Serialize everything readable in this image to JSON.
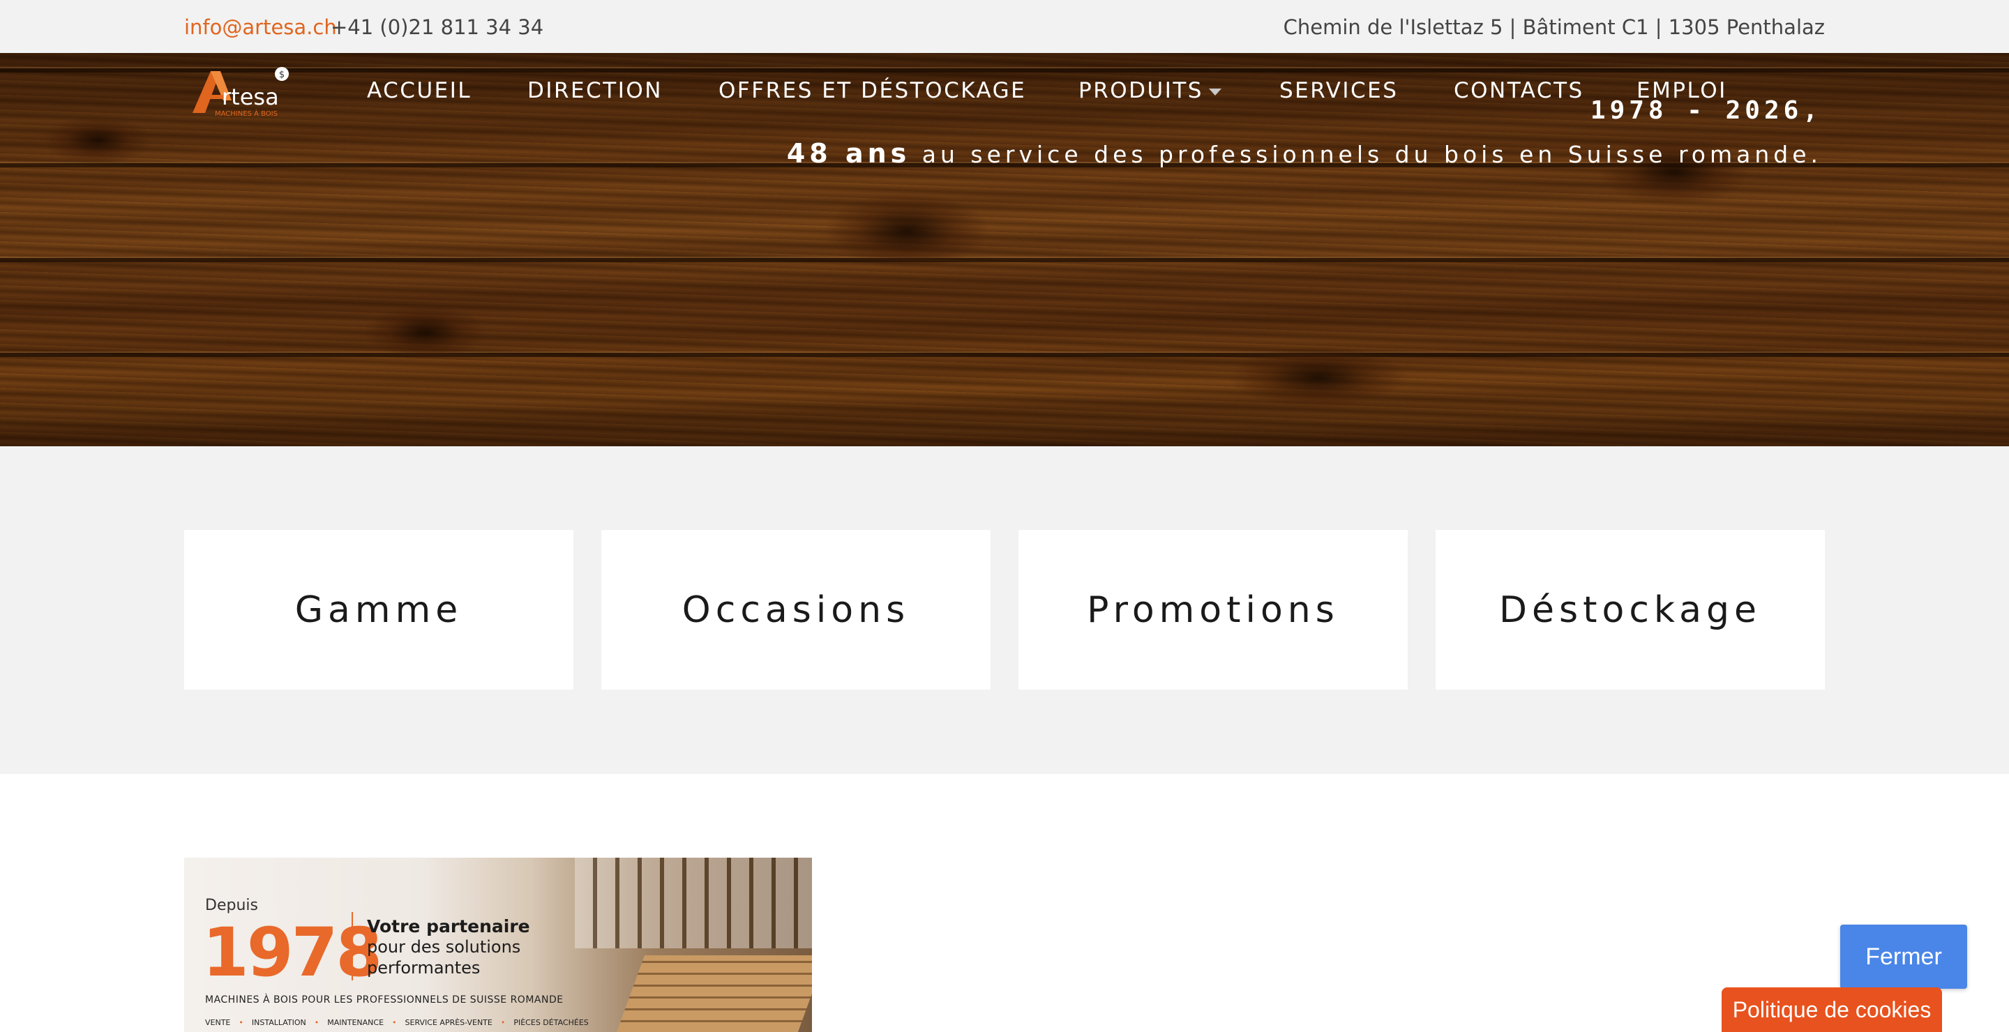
{
  "topbar": {
    "email": "info@artesa.ch",
    "phone": "+41 (0)21 811 34 34",
    "address": "Chemin de l'Islettaz 5 | Bâtiment C1 | 1305 Penthalaz"
  },
  "logo": {
    "name": "Artesa",
    "subtitle": "MACHINES À BOIS"
  },
  "nav": {
    "items": [
      {
        "label": "ACCUEIL"
      },
      {
        "label": "DIRECTION"
      },
      {
        "label": "OFFRES ET DÉSTOCKAGE"
      },
      {
        "label": "PRODUITS"
      },
      {
        "label": "SERVICES"
      },
      {
        "label": "CONTACTS"
      },
      {
        "label": "EMPLOI"
      }
    ]
  },
  "hero": {
    "years": "1978 - 2026,",
    "highlight": "48 ans",
    "tagline": "au service des professionnels du bois en Suisse romande."
  },
  "categories": [
    {
      "label": "Gamme"
    },
    {
      "label": "Occasions"
    },
    {
      "label": "Promotions"
    },
    {
      "label": "Déstockage"
    }
  ],
  "banner": {
    "depuis": "Depuis",
    "year": "1978",
    "line1": "Votre partenaire",
    "line2": "pour des solutions",
    "line3": "performantes",
    "subtitle": "MACHINES À BOIS POUR LES PROFESSIONNELS DE SUISSE ROMANDE",
    "services": [
      "VENTE",
      "INSTALLATION",
      "MAINTENANCE",
      "SERVICE APRÈS-VENTE",
      "PIÈCES DÉTACHÉES"
    ]
  },
  "cookies": {
    "close_label": "Fermer",
    "policy_label": "Politique de cookies"
  },
  "colors": {
    "accent": "#e0651f",
    "button_blue": "#4a86e8",
    "cookie_orange": "#e8521e"
  }
}
